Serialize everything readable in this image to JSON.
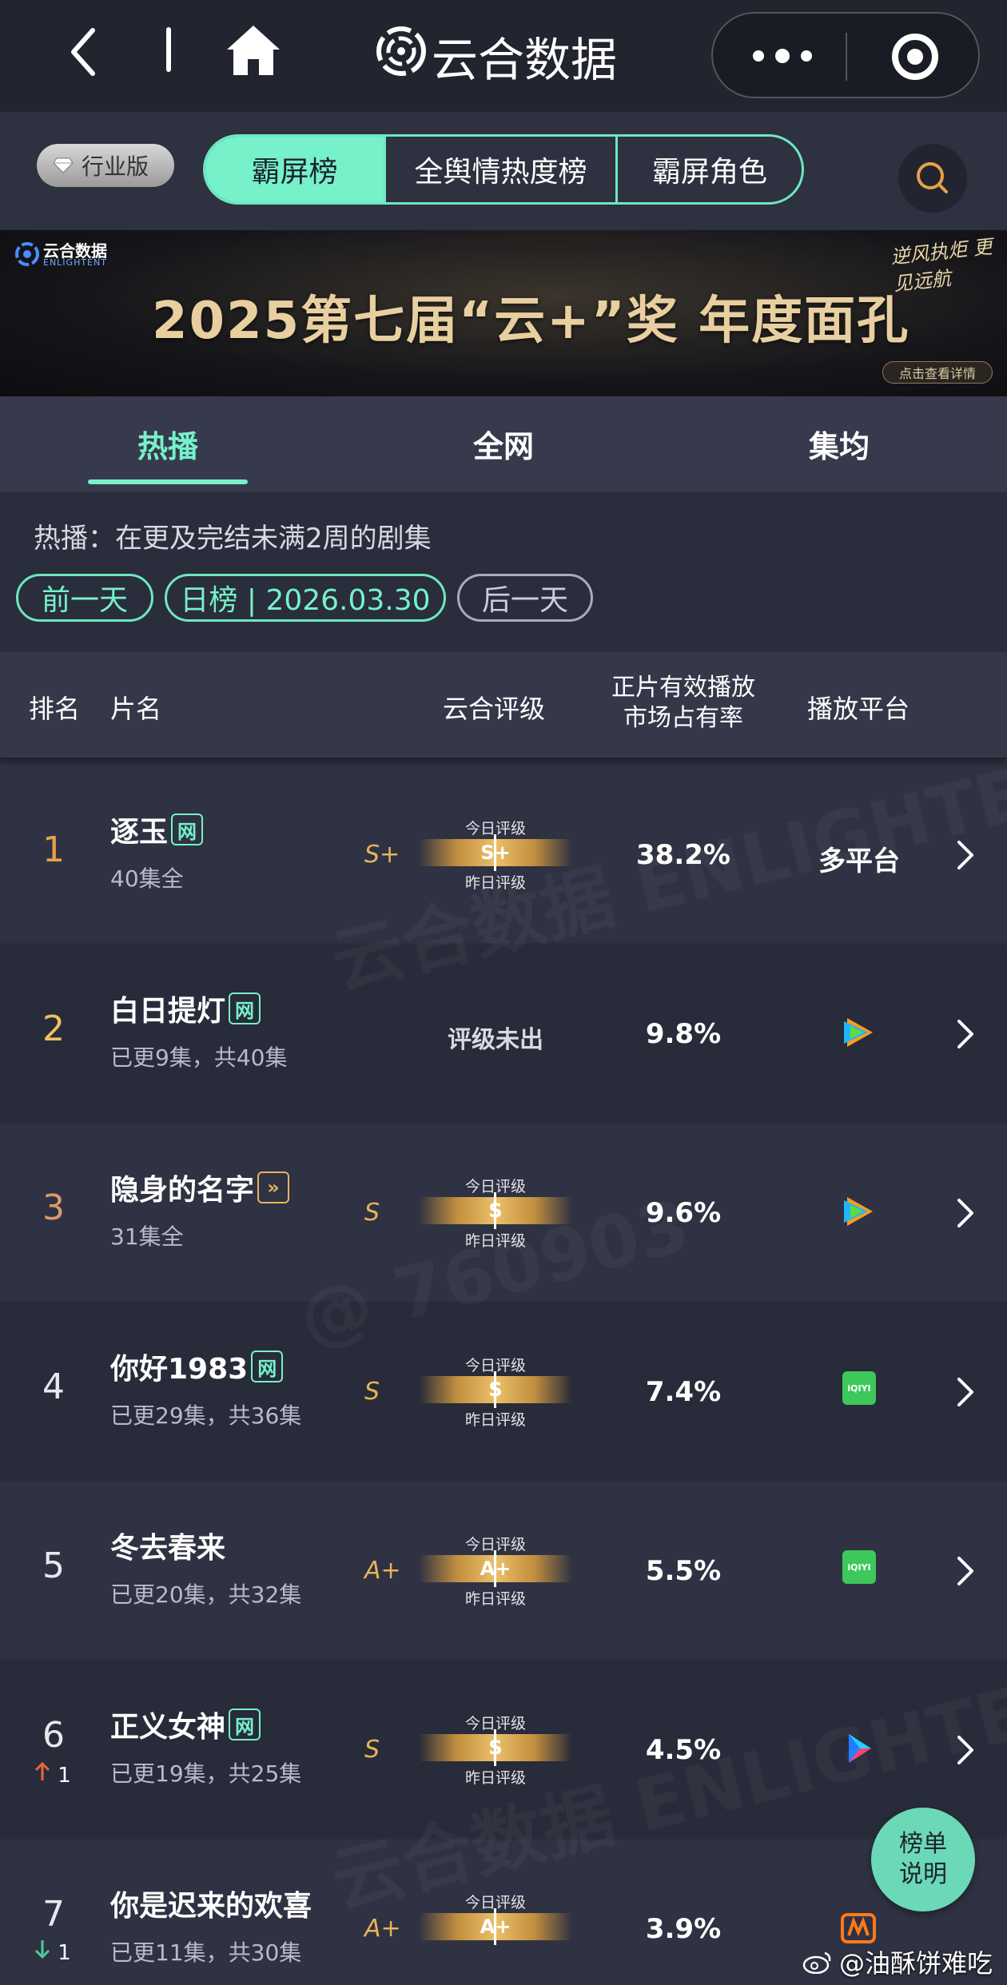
{
  "topbar": {
    "title": "云合数据",
    "icons": [
      "back-icon",
      "separator",
      "home-icon",
      "logo-icon",
      "more-icon",
      "target-icon"
    ]
  },
  "filter": {
    "industry_label": "行业版",
    "segments": [
      {
        "label": "霸屏榜",
        "active": true
      },
      {
        "label": "全舆情热度榜",
        "active": false
      },
      {
        "label": "霸屏角色",
        "active": false
      }
    ]
  },
  "banner": {
    "brand": "云合数据",
    "brand_sub": "ENLIGHTENT",
    "title": "2025第七届“云+”奖  年度面孔",
    "slogan": "逆风执炬 更见远航",
    "cta": "点击查看详情"
  },
  "tabs": [
    {
      "label": "热播",
      "active": true
    },
    {
      "label": "全网",
      "active": false
    },
    {
      "label": "集均",
      "active": false
    }
  ],
  "info": {
    "description": "热播：在更及完结未满2周的剧集",
    "prev_day": "前一天",
    "current": "日榜 | 2026.03.30",
    "next_day": "后一天"
  },
  "table": {
    "headers": {
      "rank": "排名",
      "name": "片名",
      "grade": "云合评级",
      "share_line1": "正片有效播放",
      "share_line2": "市场占有率",
      "platform": "播放平台"
    },
    "grade_today": "今日评级",
    "grade_yesterday": "昨日评级",
    "rows": [
      {
        "rank": "1",
        "title": "逐玉",
        "tag": "网",
        "tag_color": "#76f1c9",
        "episodes": "40集全",
        "grade_left": "S+",
        "grade": "S+",
        "share": "38.2%",
        "platform": "多平台",
        "platform_icon": "",
        "rank_color": "#e7a04a",
        "delta": ""
      },
      {
        "rank": "2",
        "title": "白日提灯",
        "tag": "网",
        "tag_color": "#76f1c9",
        "episodes": "已更9集，共40集",
        "grade_left": "",
        "grade": "",
        "no_grade": "评级未出",
        "share": "9.8%",
        "platform": "",
        "platform_icon": "tencent-video-icon",
        "rank_color": "#f0c060",
        "delta": ""
      },
      {
        "rank": "3",
        "title": "隐身的名字",
        "tag": "»",
        "tag_color": "#e7b45a",
        "episodes": "31集全",
        "grade_left": "S",
        "grade": "S",
        "share": "9.6%",
        "platform": "",
        "platform_icon": "tencent-video-icon",
        "rank_color": "#d99a6a",
        "delta": ""
      },
      {
        "rank": "4",
        "title": "你好1983",
        "tag": "网",
        "tag_color": "#76f1c9",
        "episodes": "已更29集，共36集",
        "grade_left": "S",
        "grade": "S",
        "share": "7.4%",
        "platform": "",
        "platform_icon": "iqiyi-icon",
        "platform_icon_text": "iQIYI",
        "rank_color": "#e8e8ee",
        "delta": ""
      },
      {
        "rank": "5",
        "title": "冬去春来",
        "tag": "",
        "tag_color": "",
        "episodes": "已更20集，共32集",
        "grade_left": "A+",
        "grade": "A+",
        "share": "5.5%",
        "platform": "",
        "platform_icon": "iqiyi-icon",
        "platform_icon_text": "iQIYI",
        "rank_color": "#e8e8ee",
        "delta": ""
      },
      {
        "rank": "6",
        "title": "正义女神",
        "tag": "网",
        "tag_color": "#76f1c9",
        "episodes": "已更19集，共25集",
        "grade_left": "S",
        "grade": "S",
        "share": "4.5%",
        "platform": "",
        "platform_icon": "youku-icon",
        "rank_color": "#e8e8ee",
        "delta": "1",
        "delta_dir": "up"
      },
      {
        "rank": "7",
        "title": "你是迟来的欢喜",
        "tag": "",
        "tag_color": "",
        "episodes": "已更11集，共30集",
        "grade_left": "A+",
        "grade": "A+",
        "share": "3.9%",
        "platform": "",
        "platform_icon": "mango-tv-icon",
        "rank_color": "#e8e8ee",
        "delta": "1",
        "delta_dir": "down"
      }
    ]
  },
  "float_button": {
    "line1": "榜单",
    "line2": "说明"
  },
  "weibo_handle": "@油酥饼难吃",
  "watermark": "云合数据 ENLIGHTENT",
  "watermark_id": "@ 760903",
  "colors": {
    "accent": "#76f1c9",
    "gold": "#e7b45a",
    "up": "#e8663a",
    "down": "#4ec99a"
  }
}
